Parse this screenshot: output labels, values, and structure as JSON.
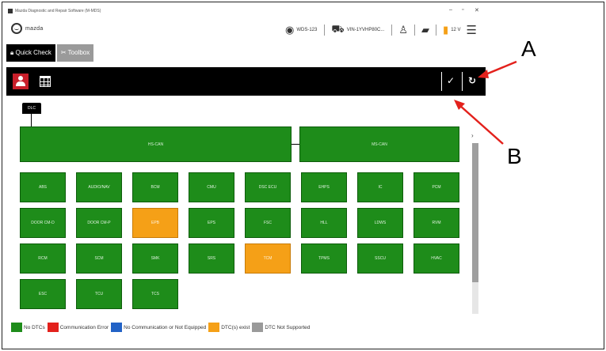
{
  "window": {
    "title": "Mazda Diagnostic and Repair Software (M-MDS)"
  },
  "header": {
    "brand": "mazda",
    "user_text": "WDS-123",
    "vehicle_text": "VIN-1YVHP80C...",
    "battery_text": "12 V"
  },
  "tabs": [
    {
      "label": "Quick Check",
      "active": true
    },
    {
      "label": "Toolbox",
      "active": false
    }
  ],
  "toolbar": {
    "left_icons": [
      "person-icon",
      "table-icon"
    ],
    "right_icons": [
      "wrench-check-icon",
      "refresh-icon"
    ]
  },
  "network": {
    "tag": "DLC",
    "buses": [
      {
        "label": "HS-CAN"
      },
      {
        "label": "MS-CAN"
      }
    ],
    "modules": [
      {
        "label": "ABS",
        "status": "no-dtc"
      },
      {
        "label": "AUDIO/NAV",
        "status": "no-dtc"
      },
      {
        "label": "BCM",
        "status": "no-dtc"
      },
      {
        "label": "CMU",
        "status": "no-dtc"
      },
      {
        "label": "DSC ECU",
        "status": "no-dtc"
      },
      {
        "label": "EHPS",
        "status": "no-dtc"
      },
      {
        "label": "IC",
        "status": "no-dtc"
      },
      {
        "label": "PCM",
        "status": "no-dtc"
      },
      {
        "label": "DOOR CM-D",
        "status": "no-dtc"
      },
      {
        "label": "DOOR CM-P",
        "status": "no-dtc"
      },
      {
        "label": "EPB",
        "status": "dtc"
      },
      {
        "label": "EPS",
        "status": "no-dtc"
      },
      {
        "label": "FSC",
        "status": "no-dtc"
      },
      {
        "label": "HLL",
        "status": "no-dtc"
      },
      {
        "label": "LDWS",
        "status": "no-dtc"
      },
      {
        "label": "RVM",
        "status": "no-dtc"
      },
      {
        "label": "RCM",
        "status": "no-dtc"
      },
      {
        "label": "SCM",
        "status": "no-dtc"
      },
      {
        "label": "SMK",
        "status": "no-dtc"
      },
      {
        "label": "SRS",
        "status": "no-dtc"
      },
      {
        "label": "TCM",
        "status": "dtc"
      },
      {
        "label": "TPMS",
        "status": "no-dtc"
      },
      {
        "label": "SSCU",
        "status": "no-dtc"
      },
      {
        "label": "HVAC",
        "status": "no-dtc"
      },
      {
        "label": "ESC",
        "status": "no-dtc"
      },
      {
        "label": "TCU",
        "status": "no-dtc"
      },
      {
        "label": "TCS",
        "status": "no-dtc"
      }
    ]
  },
  "legend": [
    {
      "label": "No DTCs",
      "color": "#1e8c1a"
    },
    {
      "label": "Communication Error",
      "color": "#e3211c"
    },
    {
      "label": "No Communication or Not Equipped",
      "color": "#2262c6"
    },
    {
      "label": "DTC(s) exist",
      "color": "#f5a017"
    },
    {
      "label": "DTC Not Supported",
      "color": "#9a9a9a"
    }
  ],
  "callouts": {
    "a": "A",
    "b": "B"
  },
  "colors": {
    "no_dtc": "#1e8c1a",
    "dtc": "#f5a017",
    "toolbar": "#000000",
    "active_tab": "#000000"
  }
}
